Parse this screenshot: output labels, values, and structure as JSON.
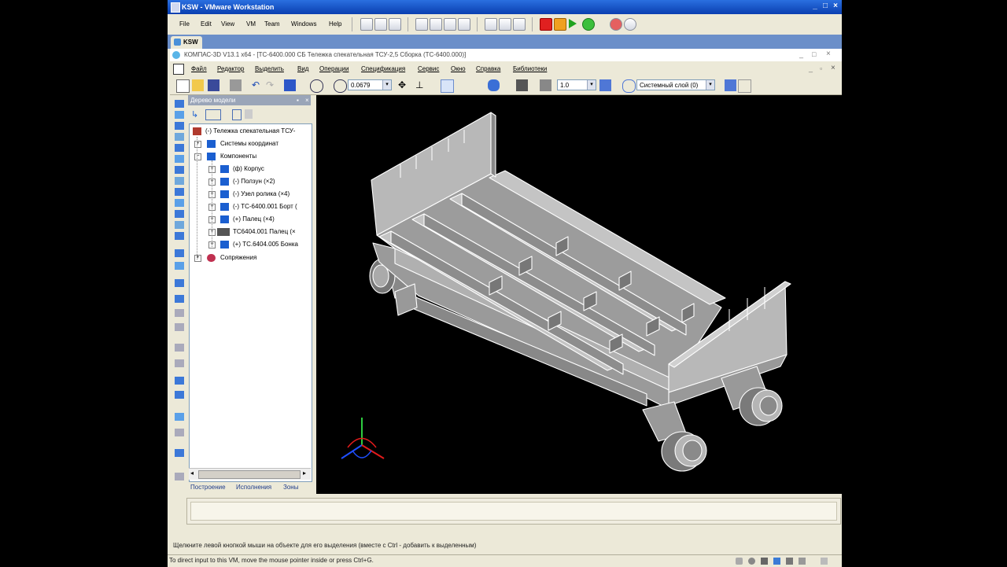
{
  "vmware": {
    "title": "KSW - VMware Workstation",
    "menu": [
      "File",
      "Edit",
      "View",
      "VM",
      "Team",
      "Windows",
      "Help"
    ],
    "tab_label": "KSW",
    "status_hint": "To direct input to this VM, move the mouse pointer inside or press Ctrl+G."
  },
  "kompas": {
    "title": "КОМПАС-3D V13.1 x64 - [ТС-6400.000 СБ Тележка спекательная ТСУ-2,5 Сборка (ТС-6400.000)]",
    "menu": [
      "Файл",
      "Редактор",
      "Выделить",
      "Вид",
      "Операции",
      "Спецификация",
      "Сервис",
      "Окно",
      "Справка",
      "Библиотеки"
    ],
    "toolbar": {
      "zoom_value": "0.0679",
      "step_value": "1.0",
      "layer_value": "Системный слой (0)"
    },
    "tree": {
      "panel_title": "Дерево модели",
      "root": "(-) Тележка спекательная ТСУ-",
      "coord_systems": "Системы координат",
      "components_label": "Компоненты",
      "components": [
        "(ф) Корпус",
        "(-) Ползун (×2)",
        "(-) Узел ролика (×4)",
        "(-) ТС-6400.001 Борт (",
        "(+) Палец (×4)",
        "ТС6404.001 Палец (×",
        "(+) ТС.6404.005 Бонка"
      ],
      "mates": "Сопряжения",
      "tabs": [
        "Построение",
        "Исполнения",
        "Зоны"
      ]
    },
    "status_text": "Щелкните левой кнопкой мыши на объекте для его выделения (вместе с Ctrl - добавить к выделенным)"
  },
  "colors": {
    "model_fill": "#a6a6a6",
    "model_edge": "#ffffff",
    "viewport_bg": "#000000",
    "vm_title_blue": "#0a3fb0",
    "tree_icon_blue": "#1b5fd0"
  }
}
